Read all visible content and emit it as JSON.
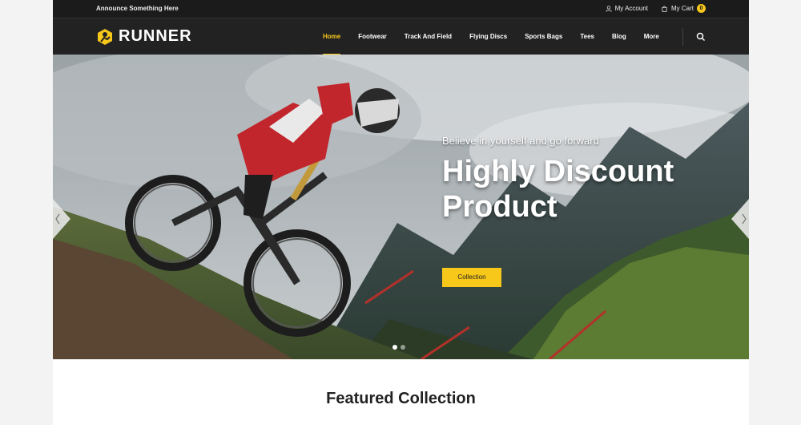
{
  "topbar": {
    "announcement": "Announce Something Here",
    "account_label": "My Account",
    "cart_label": "My Cart",
    "cart_count": "0"
  },
  "brand": {
    "name": "RUNNER",
    "accent": "#f7c71a"
  },
  "nav": {
    "items": [
      {
        "label": "Home",
        "active": true
      },
      {
        "label": "Footwear"
      },
      {
        "label": "Track And Field"
      },
      {
        "label": "Flying Discs"
      },
      {
        "label": "Sports Bags"
      },
      {
        "label": "Tees"
      },
      {
        "label": "Blog"
      },
      {
        "label": "More"
      }
    ],
    "search_icon": "search-icon"
  },
  "hero": {
    "subtitle": "Believe in yourself and go forward",
    "title_line1": "Highly Discount",
    "title_line2": "Product",
    "button_label": "Collection",
    "slide_count": 2,
    "active_slide": 1
  },
  "featured": {
    "title": "Featured Collection"
  }
}
